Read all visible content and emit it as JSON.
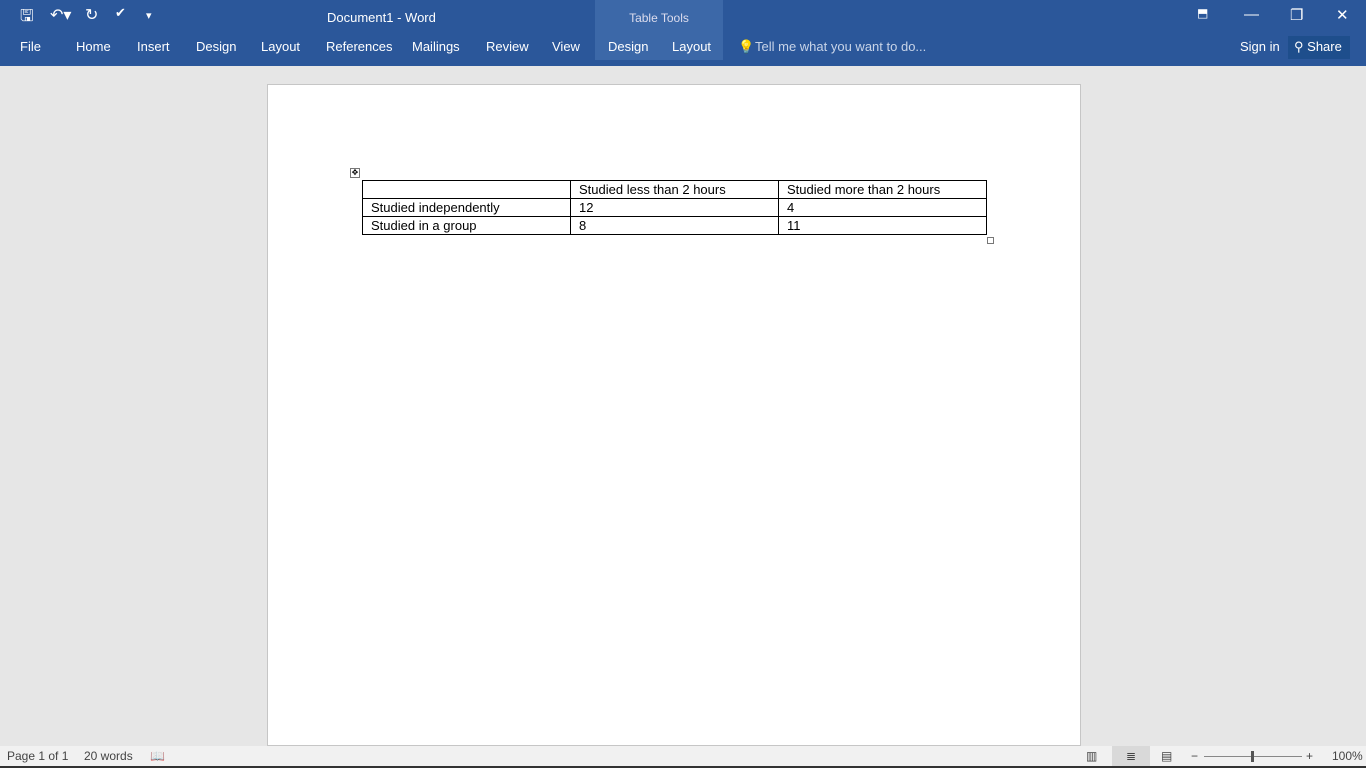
{
  "window": {
    "title": "Document1 - Word",
    "context_label": "Table Tools"
  },
  "tabs": [
    "File",
    "Home",
    "Insert",
    "Design",
    "Layout",
    "References",
    "Mailings",
    "Review",
    "View",
    "Design",
    "Layout"
  ],
  "tell_me": "Tell me what you want to do...",
  "sign_in": "Sign in",
  "share": "Share",
  "table": {
    "header": [
      "",
      "Studied less than 2 hours",
      "Studied more than 2 hours"
    ],
    "rows": [
      [
        "Studied independently",
        "12",
        "4"
      ],
      [
        "Studied in a group",
        "8",
        "11"
      ]
    ]
  },
  "status": {
    "page": "Page 1 of 1",
    "words": "20 words",
    "zoom": "100%"
  }
}
